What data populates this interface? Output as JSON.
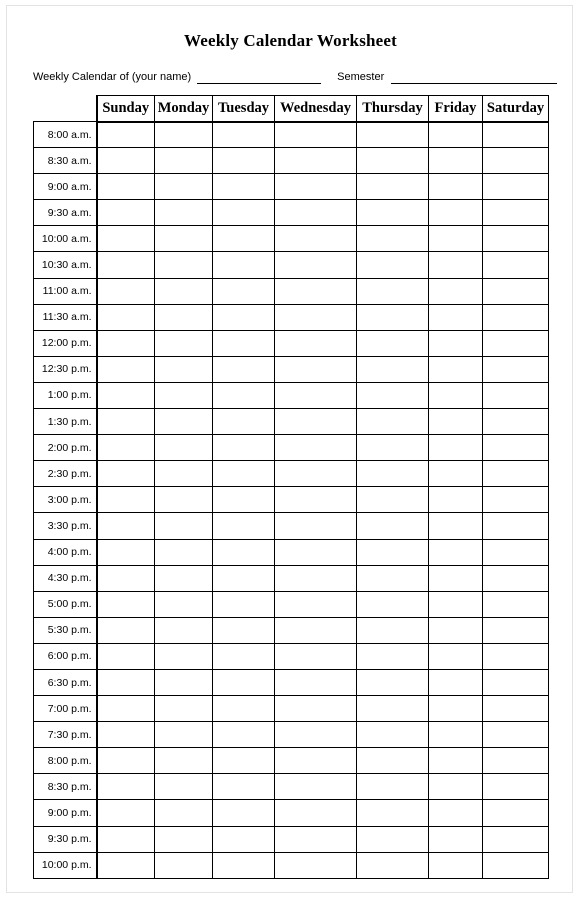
{
  "document": {
    "title": "Weekly Calendar Worksheet"
  },
  "subtitle": {
    "name_label": "Weekly Calendar of (your name)",
    "name_value": "",
    "semester_label": "Semester",
    "semester_value": ""
  },
  "table": {
    "time_header": "",
    "day_headers": [
      "Sunday",
      "Monday",
      "Tuesday",
      "Wednesday",
      "Thursday",
      "Friday",
      "Saturday"
    ],
    "time_slots": [
      "8:00 a.m.",
      "8:30 a.m.",
      "9:00 a.m.",
      "9:30 a.m.",
      "10:00 a.m.",
      "10:30 a.m.",
      "11:00 a.m.",
      "11:30 a.m.",
      "12:00 p.m.",
      "12:30 p.m.",
      "1:00 p.m.",
      "1:30 p.m.",
      "2:00 p.m.",
      "2:30 p.m.",
      "3:00 p.m.",
      "3:30 p.m.",
      "4:00 p.m.",
      "4:30 p.m.",
      "5:00 p.m.",
      "5:30 p.m.",
      "6:00 p.m.",
      "6:30 p.m.",
      "7:00 p.m.",
      "7:30 p.m.",
      "8:00 p.m.",
      "8:30 p.m.",
      "9:00 p.m.",
      "9:30 p.m.",
      "10:00 p.m."
    ],
    "entries": []
  },
  "colors": {
    "ink": "#000000",
    "paper": "#ffffff",
    "page_border": "#e3e3e3"
  }
}
